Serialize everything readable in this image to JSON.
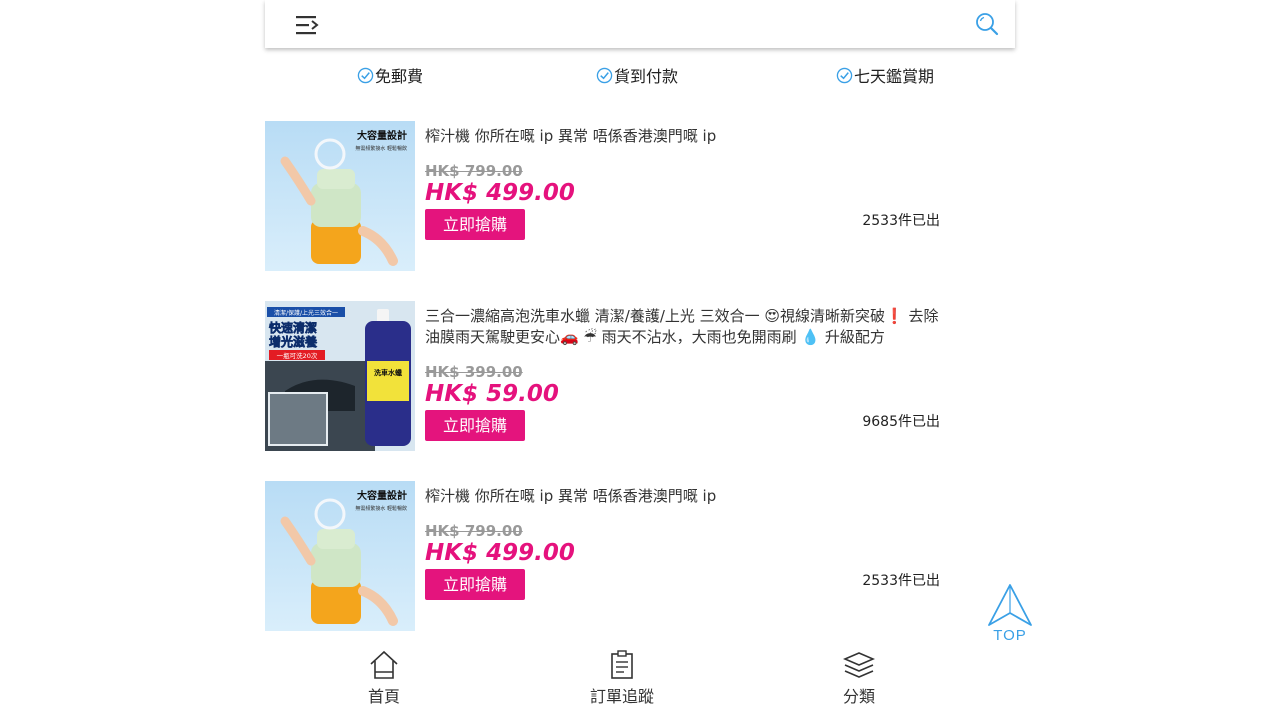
{
  "header": {
    "menu_icon": "menu-icon",
    "search_icon": "search-icon"
  },
  "perks": [
    {
      "label": "免郵費",
      "icon": "check-circle-icon"
    },
    {
      "label": "貨到付款",
      "icon": "check-circle-icon"
    },
    {
      "label": "七天鑑賞期",
      "icon": "check-circle-icon"
    }
  ],
  "products": [
    {
      "title": "榨汁機 你所在嘅 ip 異常 唔係香港澳門嘅 ip",
      "old_price": "HK$ 799.00",
      "price": "HK$ 499.00",
      "button": "立即搶購",
      "sold": "2533件已出",
      "image_text": [
        "大容量設計",
        "無需頻繁接水 輕鬆暢飲"
      ]
    },
    {
      "title": "三合一濃縮高泡洗車水蠟 清潔/養護/上光 三效合一 😍視線清晰新突破❗ 去除油膜雨天駕駛更安心🚗 ☔ 雨天不沾水，大雨也免開雨刷 💧 升級配方",
      "old_price": "HK$ 399.00",
      "price": "HK$ 59.00",
      "button": "立即搶購",
      "sold": "9685件已出",
      "image_text": [
        "清潔/保護/上光三效合一",
        "快速清潔",
        "增光滋養",
        "一瓶可洗20次",
        "洗車水蠟"
      ]
    },
    {
      "title": "榨汁機 你所在嘅 ip 異常 唔係香港澳門嘅 ip",
      "old_price": "HK$ 799.00",
      "price": "HK$ 499.00",
      "button": "立即搶購",
      "sold": "2533件已出",
      "image_text": [
        "大容量設計",
        "無需頻繁接水 輕鬆暢飲"
      ]
    }
  ],
  "top_button": {
    "label": "TOP",
    "icon": "arrow-up-icon"
  },
  "bottom_nav": [
    {
      "label": "首頁",
      "icon": "home-icon"
    },
    {
      "label": "訂單追蹤",
      "icon": "clipboard-icon"
    },
    {
      "label": "分類",
      "icon": "layers-icon"
    }
  ],
  "colors": {
    "accent": "#e4147d",
    "price": "#e5127d",
    "check": "#3aa0e6",
    "top": "#3aa0e6"
  }
}
